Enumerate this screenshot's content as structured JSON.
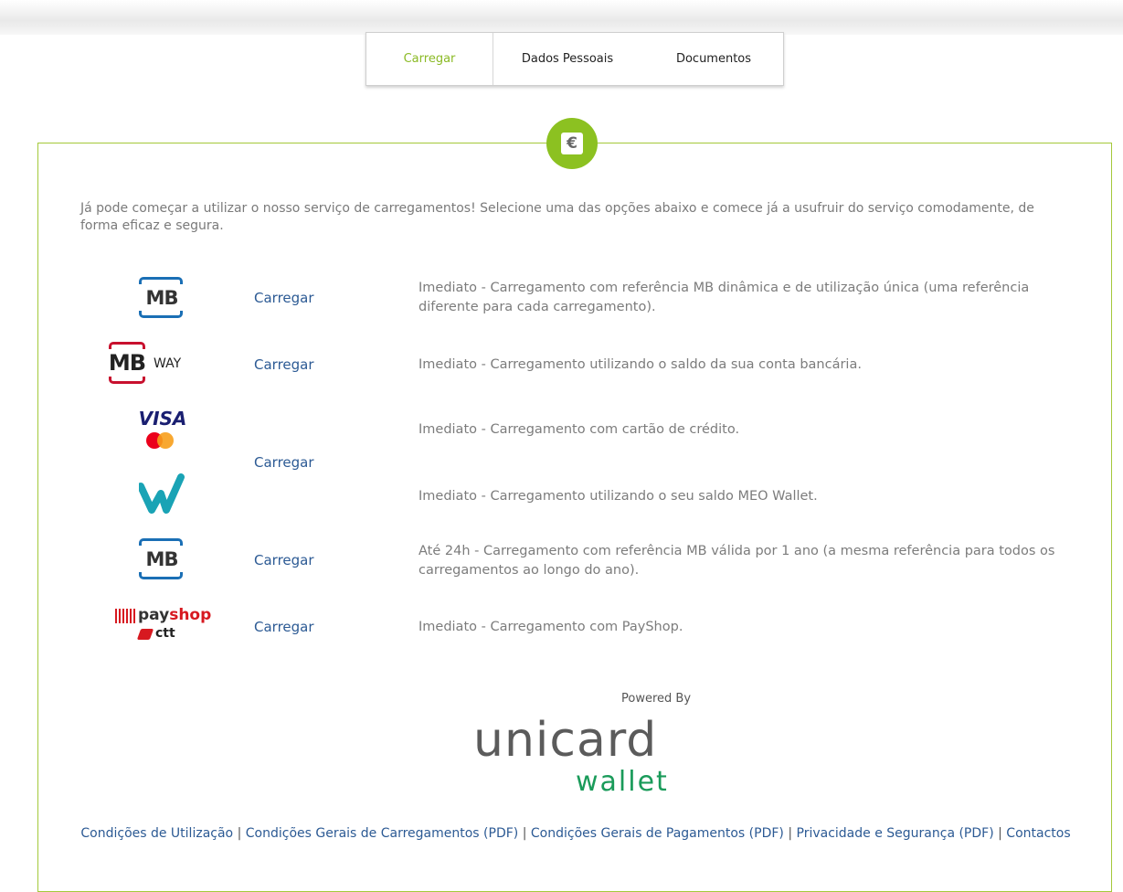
{
  "tabs": [
    {
      "label": "Carregar",
      "active": true
    },
    {
      "label": "Dados Pessoais",
      "active": false
    },
    {
      "label": "Documentos",
      "active": false
    }
  ],
  "badge": {
    "symbol": "€"
  },
  "intro_text": "Já pode começar a utilizar o nosso serviço de carregamentos! Selecione uma das opções abaixo e comece já a usufruir do serviço comodamente, de forma eficaz e segura.",
  "methods": {
    "mb_dynamic": {
      "logo_text": "MB",
      "link": "Carregar",
      "desc": "Imediato - Carregamento com referência MB dinâmica e de utilização única (uma referência diferente para cada carregamento)."
    },
    "mbway": {
      "logo_text": "MB",
      "logo_suffix": "WAY",
      "link": "Carregar",
      "desc": "Imediato - Carregamento utilizando o saldo da sua conta bancária."
    },
    "card": {
      "logo_text": "VISA",
      "link": "Carregar",
      "desc": "Imediato - Carregamento com cartão de crédito."
    },
    "meo_wallet": {
      "desc": "Imediato - Carregamento utilizando o seu saldo MEO Wallet."
    },
    "mb_annual": {
      "logo_text": "MB",
      "link": "Carregar",
      "desc": "Até 24h - Carregamento com referência MB válida por 1 ano (a mesma referência para todos os carregamentos ao longo do ano)."
    },
    "payshop": {
      "logo_pay": "pay",
      "logo_shop": "shop",
      "logo_ctt": "ctt",
      "link": "Carregar",
      "desc": "Imediato - Carregamento com PayShop."
    }
  },
  "powered_by": "Powered By",
  "brand": {
    "top": "unicard",
    "bottom": "wallet"
  },
  "footer": {
    "links": [
      "Condições de Utilização",
      "Condições Gerais de Carregamentos (PDF)",
      "Condições Gerais de Pagamentos (PDF)",
      "Privacidade e Segurança (PDF)",
      "Contactos"
    ],
    "separator": "|"
  },
  "colors": {
    "accent_green": "#8cc121",
    "panel_border": "#a4c93a",
    "link_blue": "#2c5a94",
    "mb_blue": "#1a6fb5",
    "mbway_red": "#c8102e",
    "visa_blue": "#1a1f71",
    "wallet_teal": "#1aa3b5",
    "payshop_red": "#d71920",
    "brand_green": "#1a9b5a"
  }
}
